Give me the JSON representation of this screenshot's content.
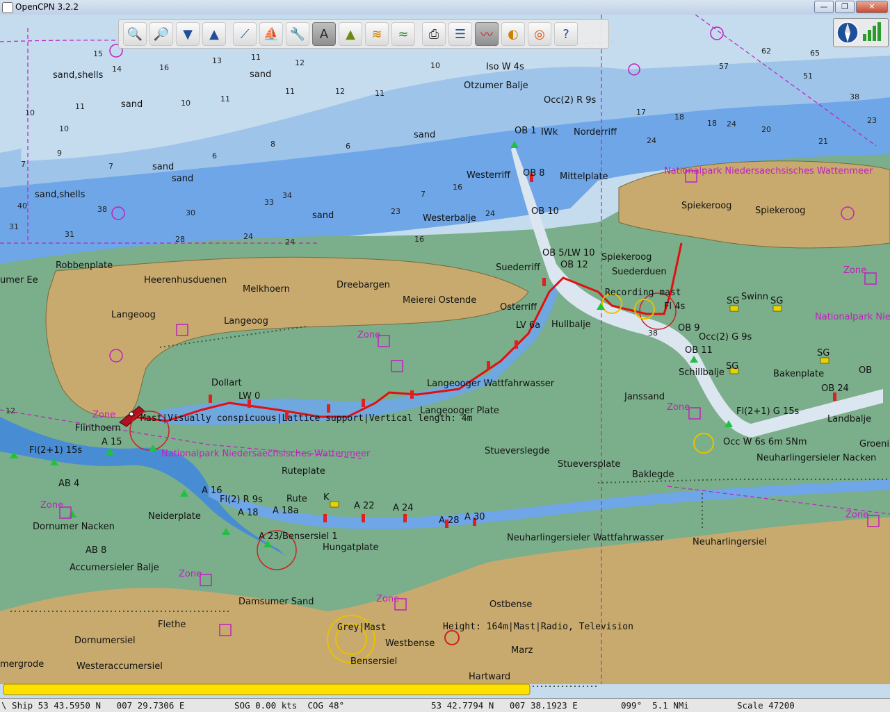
{
  "window": {
    "title": "OpenCPN 3.2.2",
    "buttons": {
      "minimize": "—",
      "maximize": "❐",
      "close": "✕"
    }
  },
  "toolbar": {
    "tools": [
      {
        "name": "zoom-in",
        "icon": "zoom-in-icon"
      },
      {
        "name": "zoom-out",
        "icon": "zoom-out-icon"
      },
      {
        "name": "scale-in",
        "icon": "scale-in-icon"
      },
      {
        "name": "scale-out",
        "icon": "scale-out-icon"
      },
      {
        "name": "route",
        "icon": "route-icon"
      },
      {
        "name": "follow",
        "icon": "follow-ship-icon"
      },
      {
        "name": "settings",
        "icon": "wrench-icon"
      },
      {
        "name": "text",
        "icon": "text-icon",
        "active": true
      },
      {
        "name": "ais",
        "icon": "ais-icon"
      },
      {
        "name": "current",
        "icon": "current-icon"
      },
      {
        "name": "tide",
        "icon": "tide-icon"
      },
      {
        "name": "print",
        "icon": "print-icon"
      },
      {
        "name": "route-manager",
        "icon": "route-manager-icon"
      },
      {
        "name": "track",
        "icon": "track-icon",
        "active": true
      },
      {
        "name": "color-scheme",
        "icon": "color-scheme-icon"
      },
      {
        "name": "mob",
        "icon": "lifebuoy-icon"
      },
      {
        "name": "help",
        "icon": "help-icon"
      }
    ]
  },
  "chart": {
    "place_names": {
      "robbenplate": "Robbenplate",
      "heerenhusduenen": "Heerenhusduenen",
      "melkhoern": "Melkhoern",
      "dreebargen": "Dreebargen",
      "meierei": "Meierei Ostende",
      "langeoog": "Langeoog",
      "langeoog2": "Langeoog",
      "dollart": "Dollart",
      "flinthoern": "Flinthoern",
      "spiekeroog": "Spiekeroog",
      "spiekeroog2": "Spiekeroog",
      "spiekeroog3": "Spiekeroog",
      "suederduen": "Suederduen",
      "ruteplate": "Ruteplate",
      "rute": "Rute",
      "neiderplate": "Neiderplate",
      "dornumer_nacken": "Dornumer Nacken",
      "accumersieler": "Accumersieler Balje",
      "damsumer": "Damsumer Sand",
      "hungatplate": "Hungatplate",
      "flethe": "Flethe",
      "dornumersiel": "Dornumersiel",
      "westeraccumersiel": "Westeraccumersiel",
      "emergrode": "mergrode",
      "westbense": "Westbense",
      "ostbense": "Ostbense",
      "marz": "Marz",
      "hartward": "Hartward",
      "bensersiel": "Bensersiel",
      "janssand": "Janssand",
      "bakenplate": "Bakenplate",
      "landbalje": "Landbalje",
      "neuharlingersiel": "Neuharlingersiel",
      "neuharlingersieler_nacken": "Neuharlingersieler Nacken",
      "groeni": "Groeni",
      "stueverslegde": "Stueverslegde",
      "stueversplate": "Stueversplate",
      "baklegde": "Baklegde",
      "schillbalje": "Schillbalje",
      "swinn": "Swinn",
      "hullbalje": "Hullbalje",
      "osterriff": "Osterriff",
      "suederriff": "Suederriff",
      "westerbalje": "Westerbalje",
      "westerriff": "Westerriff",
      "mittelplate": "Mittelplate",
      "norderriff": "Norderriff",
      "otzumer_balje": "Otzumer Balje",
      "langeooger_plate": "Langeooger Plate",
      "langeooger_wattfahrwasser": "Langeooger Wattfahrwasser",
      "neuharlingersieler_wattfahrwasser": "Neuharlingersieler Wattfahrwasser",
      "umer_ee": "umer Ee",
      "sand1": "sand",
      "sand2": "sand",
      "sand3": "sand",
      "sand4": "sand",
      "sand5": "sand",
      "sand6": "sand",
      "sandshells1": "sand,shells",
      "sandshells2": "sand,shells"
    },
    "light_labels": {
      "iso": "Iso W 4s",
      "occ2r": "Occ(2) R 9s",
      "ob1": "OB 1",
      "iwk": "IWk",
      "ob8": "OB 8",
      "ob10": "OB 10",
      "ob5": "OB 5/LW 10",
      "ob12": "OB 12",
      "fl4s": "Fl 4s",
      "ob9": "OB 9",
      "occ2g": "Occ(2) G 9s",
      "ob11": "OB 11",
      "fl21g": "Fl(2+1) G 15s",
      "ob24": "OB 24",
      "occw": "Occ W 6s 6m 5Nm",
      "fl21": "Fl(2+1) 15s",
      "flr9": "Fl(2) R 9s",
      "a16": "A 16",
      "a18": "A 18",
      "a18a": "A 18a",
      "a22": "A 22",
      "a24": "A 24",
      "a28": "A 28",
      "a30": "A 30",
      "a15": "A 15",
      "ab4": "AB 4",
      "ab8": "AB 8",
      "a23": "A 23/Bensersiel 1",
      "lw": "LW 0",
      "lv6a": "LV 6a",
      "sg1": "SG",
      "sg2": "SG",
      "sg3": "SG",
      "sg4": "SG",
      "k": "K",
      "ob_right": "OB"
    },
    "object_labels": {
      "mast": "Mast|Visually conspicuous|Lattice support|Vertical length: 4m",
      "height": "Height: 164m|Mast|Radio, Television",
      "grey_mast": "Grey|Mast",
      "recording": "Recording mast"
    },
    "magenta_labels": {
      "np1": "Nationalpark Niedersaechsisches Wattenmeer",
      "np2": "Nationalpark Niedersaechsisches Wattenmeer",
      "np3": "Nationalpark Nie",
      "zone": "Zone"
    },
    "colors": {
      "deep_water": "#c5dbee",
      "mid_water": "#9ec4ea",
      "shallow_water": "#6ea6e8",
      "channel": "#3f86e0",
      "intertidal": "#7bae8a",
      "land": "#c8aa6e",
      "route": "#e01010",
      "magenta": "#c020c0"
    }
  },
  "status": {
    "ship": "\\ Ship 53 43.5950 N   007 29.7306 E",
    "sog": "SOG 0.00 kts  COG 48°",
    "cursor": "53 42.7794 N   007 38.1923 E",
    "bearing": "099°  5.1 NMi",
    "scale": "Scale 47200"
  }
}
